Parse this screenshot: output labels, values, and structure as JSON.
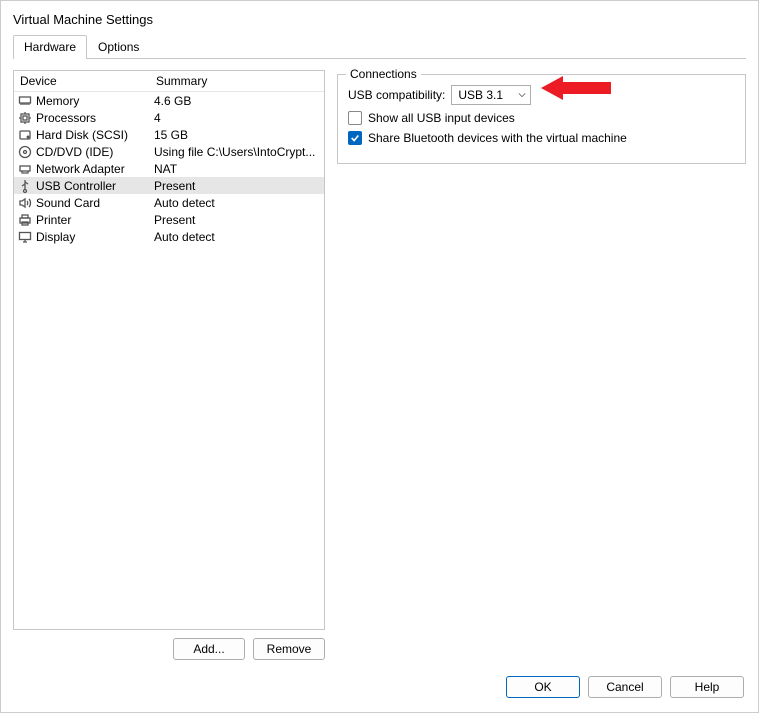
{
  "window": {
    "title": "Virtual Machine Settings"
  },
  "tabs": [
    {
      "label": "Hardware",
      "active": true
    },
    {
      "label": "Options",
      "active": false
    }
  ],
  "list": {
    "header_device": "Device",
    "header_summary": "Summary",
    "rows": [
      {
        "icon": "memory-icon",
        "device": "Memory",
        "summary": "4.6 GB",
        "selected": false
      },
      {
        "icon": "cpu-icon",
        "device": "Processors",
        "summary": "4",
        "selected": false
      },
      {
        "icon": "disk-icon",
        "device": "Hard Disk (SCSI)",
        "summary": "15 GB",
        "selected": false
      },
      {
        "icon": "cd-icon",
        "device": "CD/DVD (IDE)",
        "summary": "Using file C:\\Users\\IntoCrypt...",
        "selected": false
      },
      {
        "icon": "network-icon",
        "device": "Network Adapter",
        "summary": "NAT",
        "selected": false
      },
      {
        "icon": "usb-icon",
        "device": "USB Controller",
        "summary": "Present",
        "selected": true
      },
      {
        "icon": "sound-icon",
        "device": "Sound Card",
        "summary": "Auto detect",
        "selected": false
      },
      {
        "icon": "printer-icon",
        "device": "Printer",
        "summary": "Present",
        "selected": false
      },
      {
        "icon": "display-icon",
        "device": "Display",
        "summary": "Auto detect",
        "selected": false
      }
    ]
  },
  "buttons": {
    "add": "Add...",
    "remove": "Remove"
  },
  "connections": {
    "legend": "Connections",
    "usb_compat_label": "USB compatibility:",
    "usb_compat_value": "USB 3.1",
    "show_all_label": "Show all USB input devices",
    "show_all_checked": false,
    "share_bt_label": "Share Bluetooth devices with the virtual machine",
    "share_bt_checked": true
  },
  "footer": {
    "ok": "OK",
    "cancel": "Cancel",
    "help": "Help"
  },
  "annotation": {
    "arrow_color": "#ed1c24"
  }
}
